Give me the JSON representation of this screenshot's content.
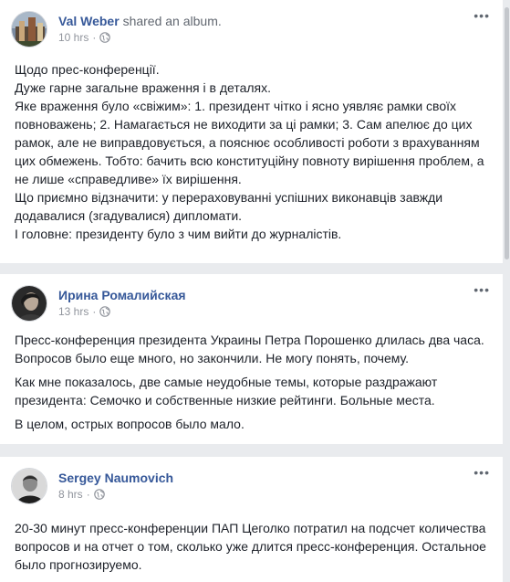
{
  "posts": [
    {
      "author": "Val Weber",
      "action": "shared an album.",
      "time": "10 hrs",
      "avatar": "painting-avatar",
      "paragraphs": [
        "Щодо прес-конференції.",
        "Дуже гарне загальне враження і в деталях.",
        "Яке враження було «свіжим»: 1. президент чітко і ясно уявляє рамки своїх повноважень; 2. Намагається не виходити за ці рамки; 3. Сам апелює до цих рамок, але не виправдовується, а пояснює особливості роботи з врахуванням цих обмежень. Тобто: бачить всю конституційну повноту вирішення проблем, а не лише «справедливе» їх вирішення.",
        "Що приємно відзначити: у перераховуванні успішних виконавців завжди додавалися (згадувалися) дипломати.",
        "І головне: президенту було з чим вийти до журналістів."
      ]
    },
    {
      "author": "Ирина Ромалийская",
      "action": "",
      "time": "13 hrs",
      "avatar": "woman-avatar",
      "paragraphs": [
        "Пресс-конференция президента Украины Петра Порошенко длилась два часа. Вопросов было еще много, но закончили. Не могу понять, почему.",
        "Как мне показалось, две самые неудобные темы, которые раздражают президента: Семочко и собственные низкие рейтинги. Больные места.",
        "В целом, острых вопросов было мало."
      ]
    },
    {
      "author": "Sergey Naumovich",
      "action": "",
      "time": "8 hrs",
      "avatar": "man-avatar",
      "paragraphs": [
        "20-30 минут пресс-конференции ПАП Цеголко потратил на подсчет количества вопросов и на отчет о том, сколько уже длится пресс-конференция. Остальное было прогнозируемо."
      ]
    }
  ],
  "more_label": "•••",
  "separator": "·",
  "icons": {
    "privacy": "globe-icon",
    "more": "more-options-icon"
  },
  "colors": {
    "link": "#365899",
    "meta": "#90949c",
    "text": "#1d2129",
    "background": "#e9ebee"
  }
}
